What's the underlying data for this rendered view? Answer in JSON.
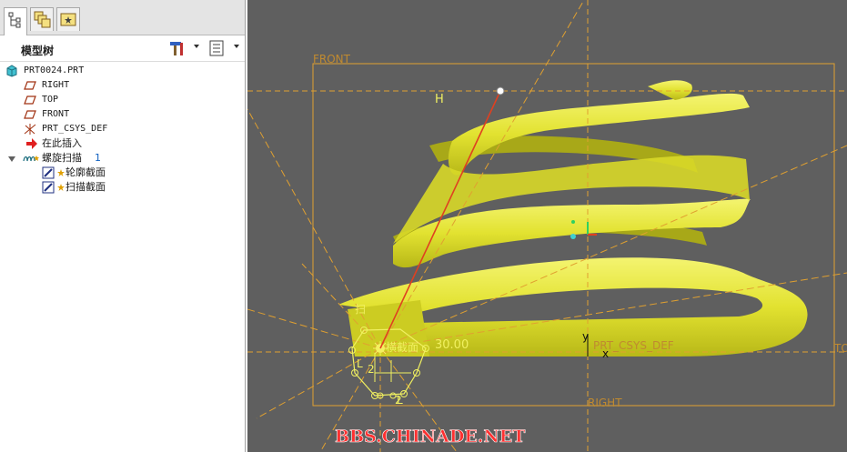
{
  "tabs": [
    {
      "icon": "model-tree-icon"
    },
    {
      "icon": "layers-icon"
    },
    {
      "icon": "favorites-folder-icon"
    }
  ],
  "tree_header": {
    "title": "模型树",
    "settings_icon": "tools-icon",
    "show_icon": "list-columns-icon"
  },
  "tree": {
    "root": "PRT0024.PRT",
    "items": [
      {
        "label": "RIGHT",
        "icon": "datum-plane-icon"
      },
      {
        "label": "TOP",
        "icon": "datum-plane-icon"
      },
      {
        "label": "FRONT",
        "icon": "datum-plane-icon"
      },
      {
        "label": "PRT_CSYS_DEF",
        "icon": "coordinate-system-icon"
      },
      {
        "label": "在此插入",
        "icon": "insert-here-arrow-icon"
      }
    ],
    "feature": {
      "label": "螺旋扫描",
      "number": "1",
      "icon": "helical-sweep-icon",
      "children": [
        {
          "label": "轮廓截面",
          "icon": "sketch-section-icon"
        },
        {
          "label": "扫描截面",
          "icon": "sketch-section-icon"
        }
      ]
    }
  },
  "viewport": {
    "plane_front": "FRONT",
    "plane_right": "RIGHT",
    "plane_top": "TO",
    "csys_label": "PRT_CSYS_DEF",
    "axis_h": "H",
    "dimension": "30.00",
    "dimension_prefix": "横截面",
    "sketch_prefix": "扫",
    "watermark": "BBS.CHINADE.NET",
    "colors": {
      "background": "#5f5f5f",
      "spring": "#e6e632",
      "datum": "#e0a030",
      "profile": "#e04020",
      "watermark": "#ff3030"
    }
  }
}
